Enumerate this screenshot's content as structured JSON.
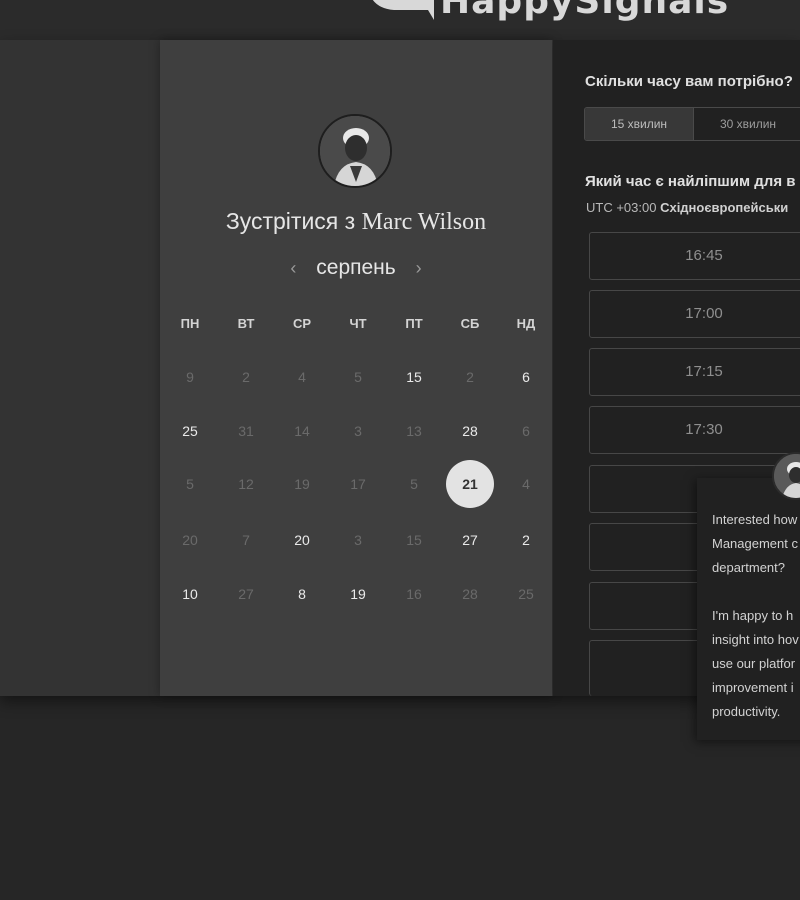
{
  "brand": {
    "name": "HappySignals"
  },
  "profile": {
    "meet_prefix": "Зустрітися з",
    "host_name": "Marc Wilson",
    "avatar_icon": "person-avatar-icon"
  },
  "calendar": {
    "month": "серпень",
    "prev_icon": "chevron-left-icon",
    "next_icon": "chevron-right-icon",
    "weekdays": [
      "ПН",
      "ВТ",
      "СР",
      "ЧТ",
      "ПТ",
      "СБ",
      "НД"
    ],
    "weeks": [
      [
        {
          "d": "9",
          "s": "off"
        },
        {
          "d": "2",
          "s": "off"
        },
        {
          "d": "4",
          "s": "off"
        },
        {
          "d": "5",
          "s": "off"
        },
        {
          "d": "15",
          "s": "on"
        },
        {
          "d": "2",
          "s": "off"
        },
        {
          "d": "6",
          "s": "on"
        }
      ],
      [
        {
          "d": "25",
          "s": "on"
        },
        {
          "d": "31",
          "s": "off"
        },
        {
          "d": "14",
          "s": "off"
        },
        {
          "d": "3",
          "s": "off"
        },
        {
          "d": "13",
          "s": "off"
        },
        {
          "d": "28",
          "s": "on"
        },
        {
          "d": "6",
          "s": "off"
        }
      ],
      [
        {
          "d": "5",
          "s": "off"
        },
        {
          "d": "12",
          "s": "off"
        },
        {
          "d": "19",
          "s": "off"
        },
        {
          "d": "17",
          "s": "off"
        },
        {
          "d": "5",
          "s": "off"
        },
        {
          "d": "21",
          "s": "sel"
        },
        {
          "d": "4",
          "s": "off"
        }
      ],
      [
        {
          "d": "20",
          "s": "off"
        },
        {
          "d": "7",
          "s": "off"
        },
        {
          "d": "20",
          "s": "on"
        },
        {
          "d": "3",
          "s": "off"
        },
        {
          "d": "15",
          "s": "off"
        },
        {
          "d": "27",
          "s": "on"
        },
        {
          "d": "2",
          "s": "on"
        }
      ],
      [
        {
          "d": "10",
          "s": "on"
        },
        {
          "d": "27",
          "s": "off"
        },
        {
          "d": "8",
          "s": "on"
        },
        {
          "d": "19",
          "s": "on"
        },
        {
          "d": "16",
          "s": "off"
        },
        {
          "d": "28",
          "s": "off"
        },
        {
          "d": "25",
          "s": "off"
        }
      ]
    ]
  },
  "booking": {
    "duration_question": "Скільки часу вам потрібно?",
    "durations": [
      {
        "label": "15 хвилин",
        "active": true
      },
      {
        "label": "30 хвилин",
        "active": false
      }
    ],
    "time_question": "Який час є найліпшим для в",
    "timezone_offset": "UTC +03:00",
    "timezone_name": "Східноєвропейськи",
    "slots": [
      "16:45",
      "17:00",
      "17:15",
      "17:30",
      "",
      "",
      ""
    ]
  },
  "chat": {
    "message": "Interested how\nManagement c\ndepartment?\n\nI'm happy to h\ninsight into hov\nuse our platfor\nimprovement i\nproductivity."
  },
  "colors": {
    "background": "#262626",
    "panel_left": "#3f3f3f",
    "panel_right": "#212121",
    "selected_day": "#e3e3e3"
  }
}
